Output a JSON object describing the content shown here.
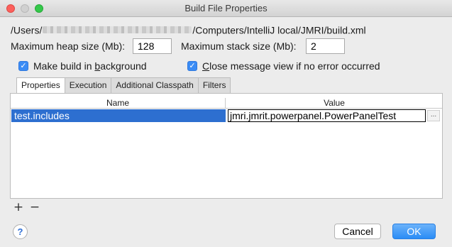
{
  "window": {
    "title": "Build File Properties"
  },
  "path": {
    "prefix": "/Users/",
    "suffix": "/Computers/IntelliJ local/JMRI/build.xml"
  },
  "heap": {
    "label": "Maximum heap size (Mb):",
    "value": "128"
  },
  "stack": {
    "label": "Maximum stack size (Mb):",
    "value": "2"
  },
  "options": {
    "background_pre": "Make build in ",
    "background_key": "b",
    "background_post": "ackground",
    "close_pre": "",
    "close_key": "C",
    "close_post": "lose message view if no error occurred"
  },
  "tabs": [
    {
      "label": "Properties"
    },
    {
      "label": "Execution"
    },
    {
      "label": "Additional Classpath"
    },
    {
      "label": "Filters"
    }
  ],
  "table": {
    "headers": {
      "name": "Name",
      "value": "Value"
    },
    "rows": [
      {
        "name": "test.includes",
        "value": "jmri.jmrit.powerpanel.PowerPanelTest"
      }
    ],
    "more_label": "..."
  },
  "toolbar": {
    "add_label": "+",
    "remove_label": "−"
  },
  "buttons": {
    "help_label": "?",
    "cancel_label": "Cancel",
    "ok_label": "OK"
  },
  "colors": {
    "selection": "#2d6fd0",
    "ok_button": "#2a8cf6",
    "checkbox": "#3b8cf5"
  }
}
